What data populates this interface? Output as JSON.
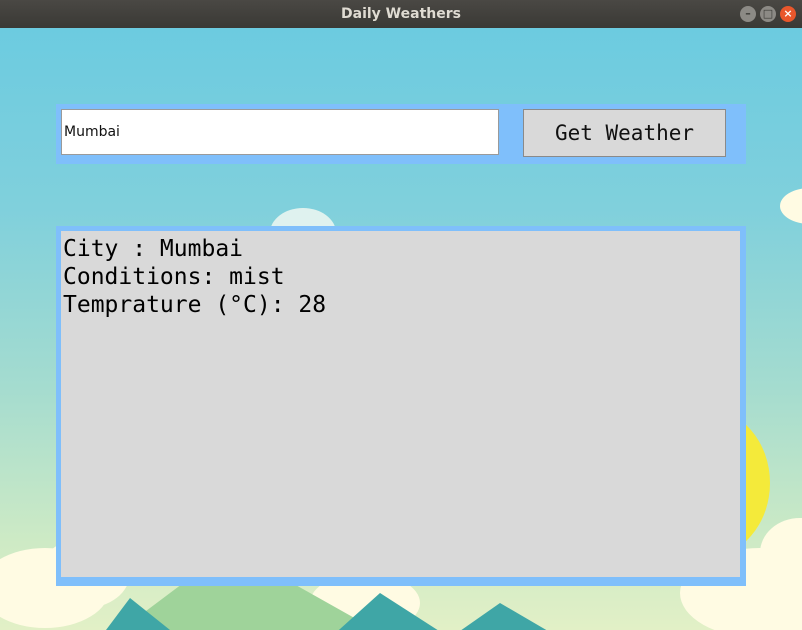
{
  "window": {
    "title": "Daily Weathers",
    "controls": [
      "minimize",
      "maximize",
      "close"
    ]
  },
  "search": {
    "value": "Mumbai",
    "button_label": "Get Weather"
  },
  "result": {
    "city_line": "City : Mumbai",
    "conditions_line": "Conditions: mist",
    "temperature_line": "Temprature (°C): 28"
  },
  "colors": {
    "panel_border": "#7fbffb",
    "panel_fill": "#d9d9d9",
    "sky_top": "#6ccbe0",
    "sun": "#f4ea3a"
  }
}
